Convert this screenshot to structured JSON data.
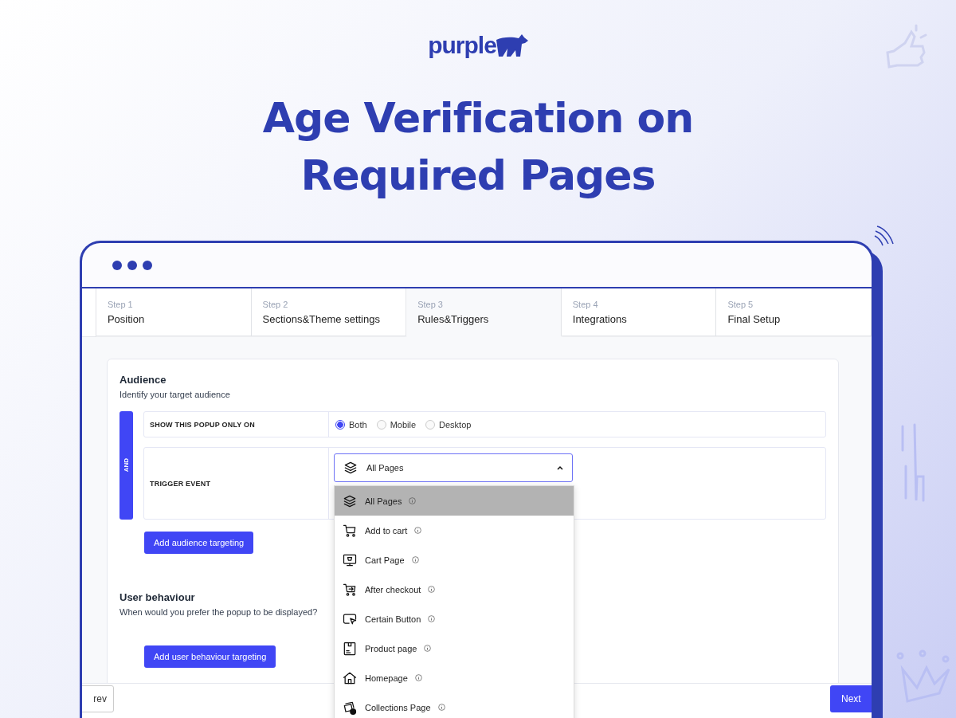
{
  "logo": {
    "text": "purple"
  },
  "headline": [
    "Age Verification on",
    "Required Pages"
  ],
  "steps": [
    {
      "step": "Step 1",
      "title": "Position",
      "selected": false
    },
    {
      "step": "Step 2",
      "title": "Sections&Theme settings",
      "selected": false
    },
    {
      "step": "Step 3",
      "title": "Rules&Triggers",
      "selected": true
    },
    {
      "step": "Step 4",
      "title": "Integrations",
      "selected": false
    },
    {
      "step": "Step 5",
      "title": "Final Setup",
      "selected": false
    }
  ],
  "audience": {
    "title": "Audience",
    "subtitle": "Identify your target audience",
    "connector": "AND",
    "device_row": {
      "label": "SHOW THIS POPUP ONLY ON",
      "options": [
        {
          "label": "Both",
          "selected": true
        },
        {
          "label": "Mobile",
          "selected": false
        },
        {
          "label": "Desktop",
          "selected": false
        }
      ]
    },
    "trigger_row": {
      "label": "TRIGGER EVENT",
      "value": "All Pages",
      "expanded": true,
      "options": [
        {
          "label": "All Pages",
          "selected": true
        },
        {
          "label": "Add to cart",
          "selected": false
        },
        {
          "label": "Cart Page",
          "selected": false
        },
        {
          "label": "After checkout",
          "selected": false
        },
        {
          "label": "Certain Button",
          "selected": false
        },
        {
          "label": "Product page",
          "selected": false
        },
        {
          "label": "Homepage",
          "selected": false
        },
        {
          "label": "Collections Page",
          "selected": false
        }
      ]
    },
    "button": "Add audience targeting"
  },
  "behaviour": {
    "title": "User behaviour",
    "subtitle": "When would you prefer the popup to be displayed?",
    "button": "Add user behaviour targeting"
  },
  "footer": {
    "prev": "rev",
    "next": "Next"
  }
}
